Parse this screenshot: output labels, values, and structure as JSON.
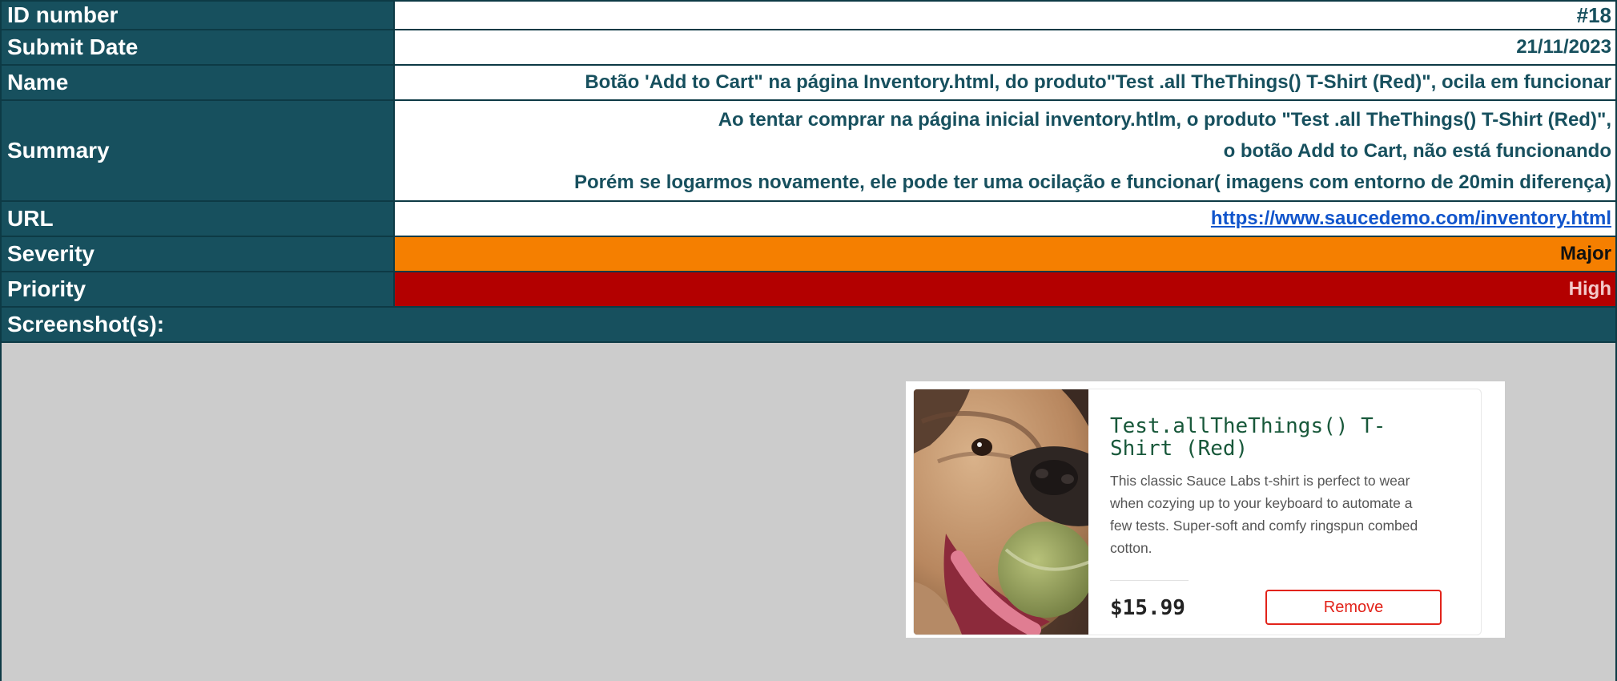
{
  "rows": {
    "id": {
      "label": "ID number",
      "value": "#18"
    },
    "date": {
      "label": "Submit Date",
      "value": "21/11/2023"
    },
    "name": {
      "label": "Name",
      "value": "Botão 'Add to Cart\" na página Inventory.html, do produto\"Test .all TheThings() T-Shirt (Red)\", ocila em funcionar"
    },
    "summary": {
      "label": "Summary",
      "lines": [
        "Ao tentar comprar na página inicial  inventory.htlm, o produto  \"Test .all TheThings() T-Shirt (Red)\",",
        "o botão Add to Cart, não está funcionando",
        "Porém se logarmos novamente, ele pode ter uma ocilação e funcionar( imagens com entorno de 20min diferença)"
      ]
    },
    "url": {
      "label": "URL",
      "value": "https://www.saucedemo.com/inventory.html"
    },
    "severity": {
      "label": "Severity",
      "value": "Major"
    },
    "priority": {
      "label": "Priority",
      "value": "High"
    },
    "screenshots": {
      "label": "Screenshot(s):"
    }
  },
  "product_card": {
    "title": "Test.allTheThings() T-Shirt (Red)",
    "description": "This classic Sauce Labs t-shirt is perfect to wear when cozying up to your keyboard to automate a few tests. Super-soft and comfy ringspun combed cotton.",
    "price": "$15.99",
    "button": "Remove",
    "image_icon": "dog-with-ball-photo"
  },
  "colors": {
    "header": "#17505e",
    "severity": "#f57f00",
    "priority": "#b30000",
    "link": "#1155cc",
    "remove": "#e2231a"
  }
}
